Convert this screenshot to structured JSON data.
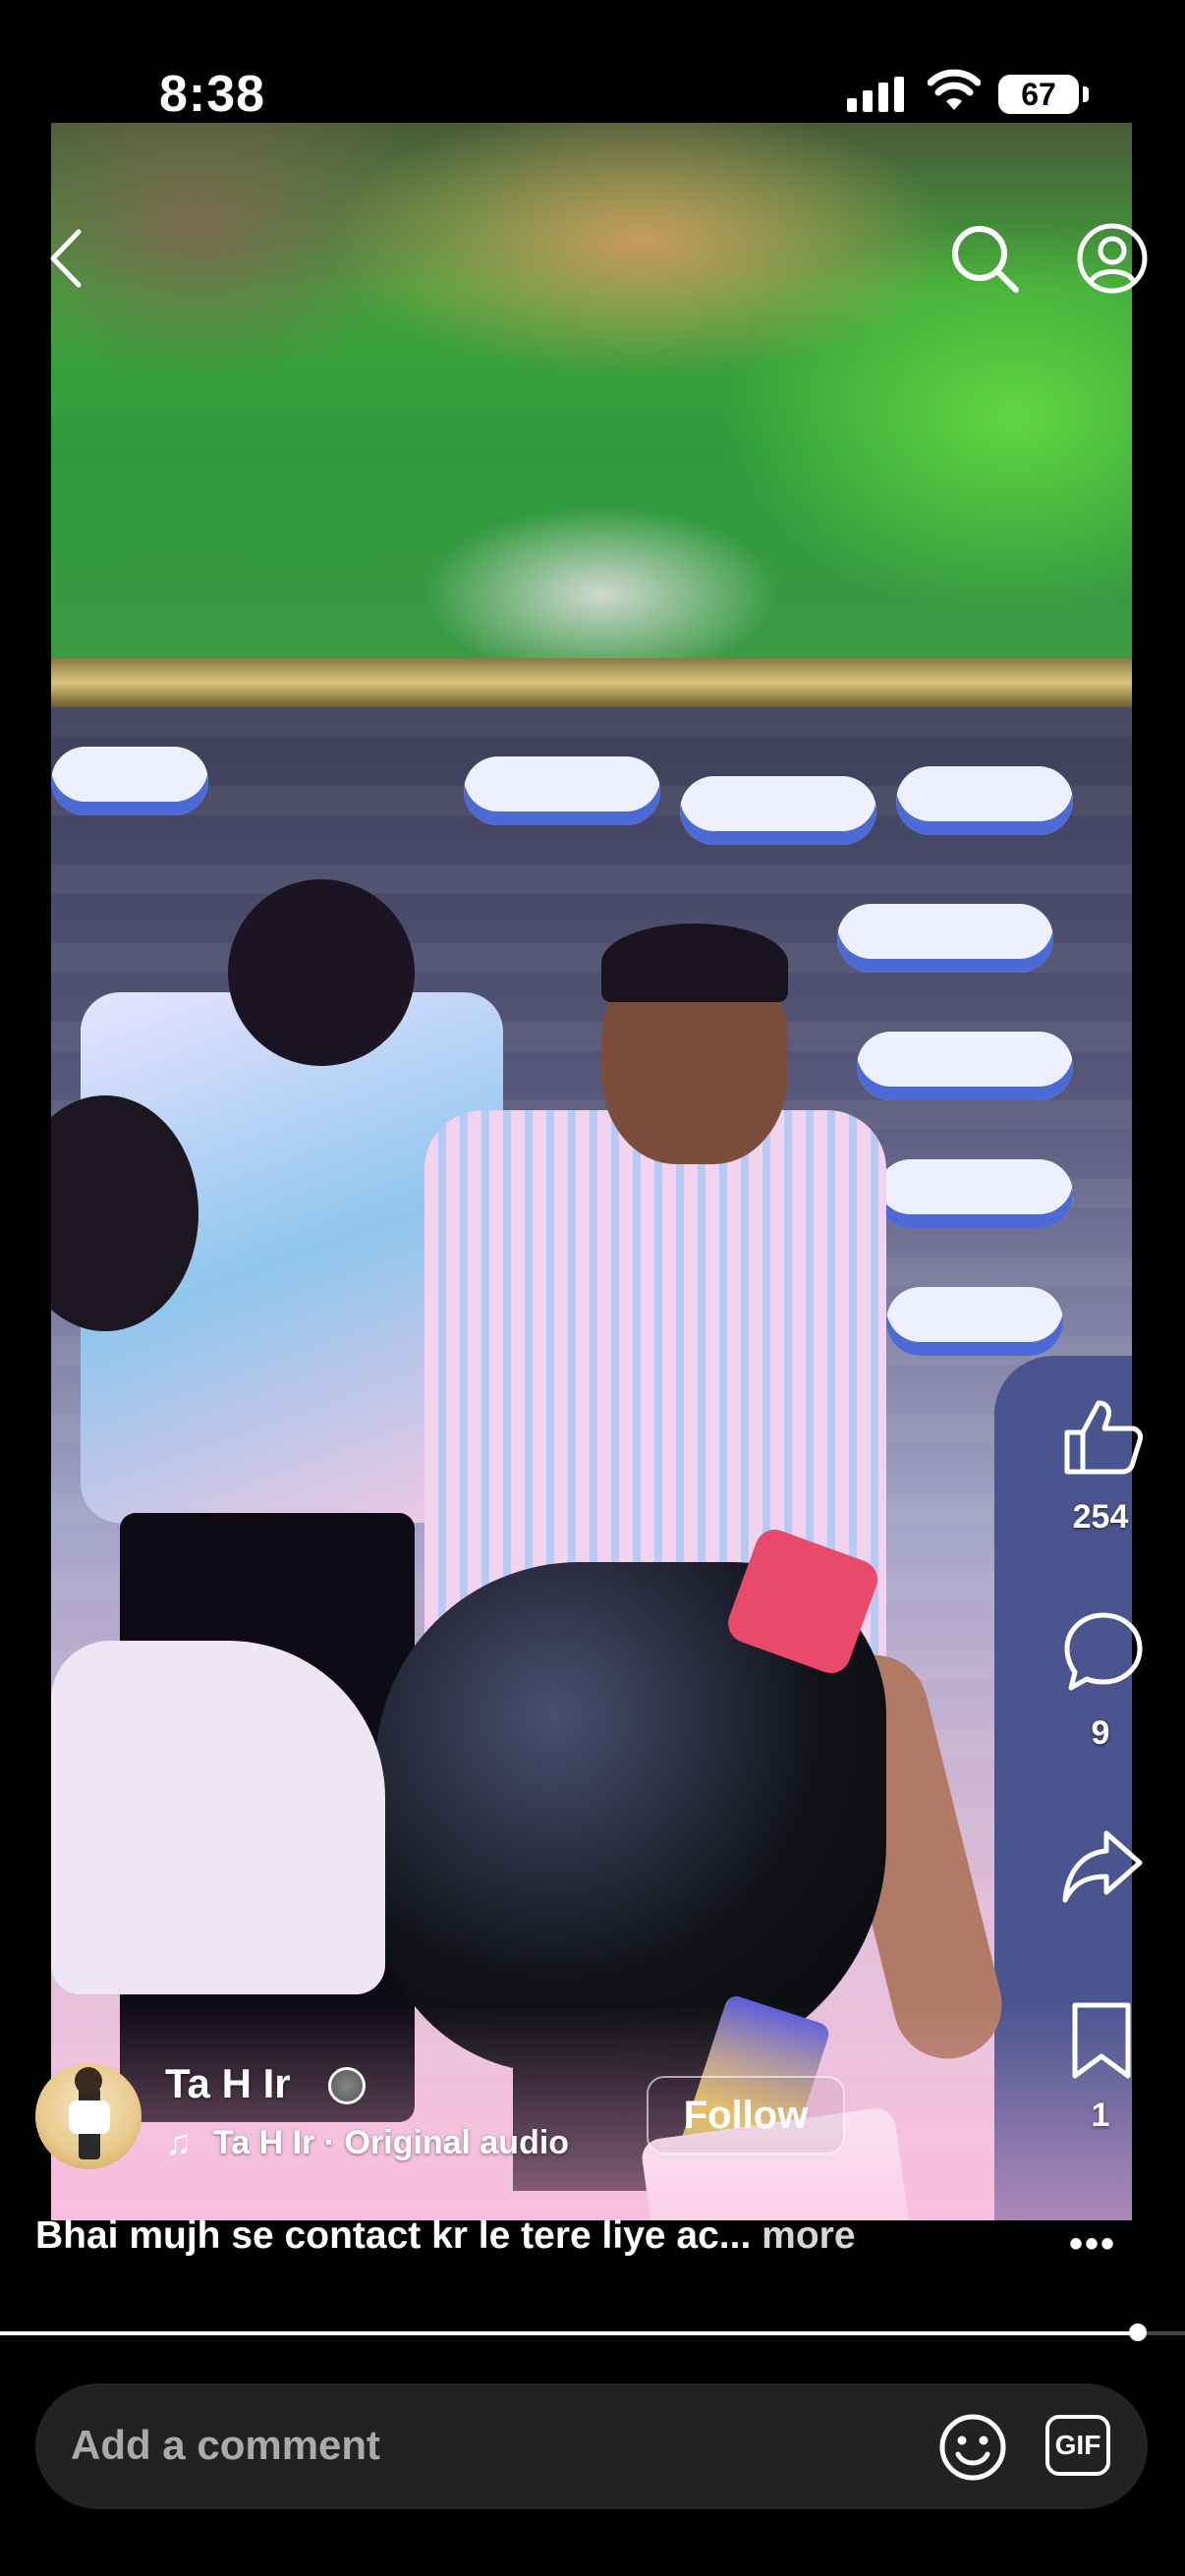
{
  "status_bar": {
    "time": "8:38",
    "battery": "67"
  },
  "top_bar": {
    "back_icon": "chevron-left-icon",
    "search_icon": "search-icon",
    "profile_icon": "profile-icon"
  },
  "actions": {
    "like_count": "254",
    "comment_count": "9",
    "save_count": "1"
  },
  "author": {
    "name": "Ta H Ir",
    "audio": "Ta H Ir · Original audio",
    "follow_label": "Follow"
  },
  "caption": {
    "text": "Bhai mujh se contact kr le tere liye ac... ",
    "more": "more"
  },
  "more_options": "•••",
  "playback": {
    "progress": 0.96
  },
  "comment_bar": {
    "placeholder": "Add a comment",
    "gif_label": "GIF"
  }
}
